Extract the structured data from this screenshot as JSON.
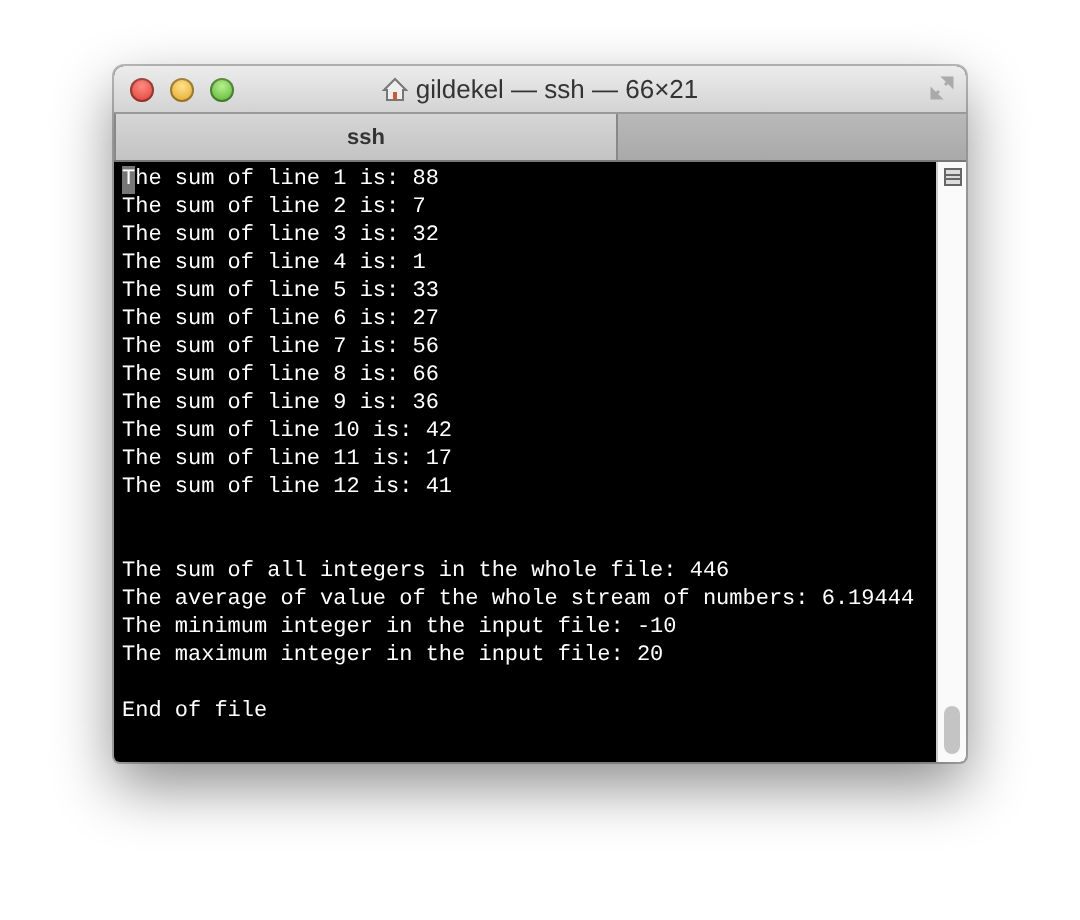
{
  "window": {
    "title": "gildekel — ssh — 66×21"
  },
  "tabs": [
    {
      "label": "ssh",
      "selected": true
    }
  ],
  "terminal": {
    "lines": [
      {
        "kind": "text",
        "text": "The sum of line 1 is: 88",
        "cursor": true
      },
      {
        "kind": "text",
        "text": "The sum of line 2 is: 7"
      },
      {
        "kind": "text",
        "text": "The sum of line 3 is: 32"
      },
      {
        "kind": "text",
        "text": "The sum of line 4 is: 1"
      },
      {
        "kind": "text",
        "text": "The sum of line 5 is: 33"
      },
      {
        "kind": "text",
        "text": "The sum of line 6 is: 27"
      },
      {
        "kind": "text",
        "text": "The sum of line 7 is: 56"
      },
      {
        "kind": "text",
        "text": "The sum of line 8 is: 66"
      },
      {
        "kind": "text",
        "text": "The sum of line 9 is: 36"
      },
      {
        "kind": "text",
        "text": "The sum of line 10 is: 42"
      },
      {
        "kind": "text",
        "text": "The sum of line 11 is: 17"
      },
      {
        "kind": "text",
        "text": "The sum of line 12 is: 41"
      },
      {
        "kind": "blank"
      },
      {
        "kind": "blank"
      },
      {
        "kind": "text",
        "text": "The sum of all integers in the whole file: 446"
      },
      {
        "kind": "text",
        "text": "The average of value of the whole stream of numbers: 6.19444"
      },
      {
        "kind": "text",
        "text": "The minimum integer in the input file: -10"
      },
      {
        "kind": "text",
        "text": "The maximum integer in the input file: 20"
      },
      {
        "kind": "blank"
      },
      {
        "kind": "text",
        "text": "End of file"
      }
    ]
  }
}
